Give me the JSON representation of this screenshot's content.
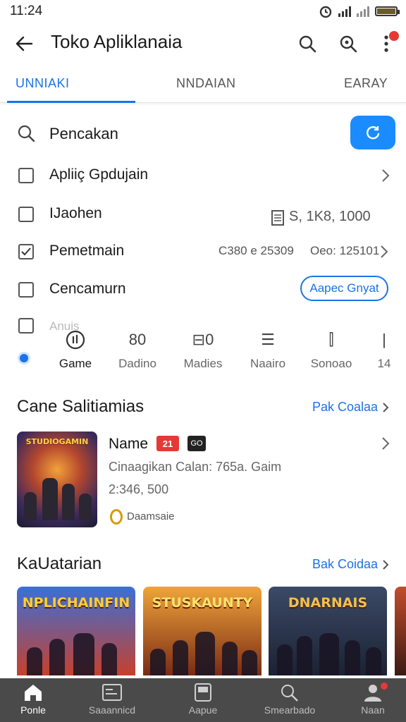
{
  "status_bar": {
    "time": "11:24"
  },
  "app_bar": {
    "title": "Toko Apliklanaia"
  },
  "tabs": [
    {
      "label": "UNNIAKI",
      "active": true
    },
    {
      "label": "NNDAIAN",
      "active": false
    },
    {
      "label": "EARAY",
      "active": false
    }
  ],
  "search": {
    "label": "Pencakan"
  },
  "filters": [
    {
      "label": "Apliiç Gpdujain",
      "checked": false
    },
    {
      "label": "IJaohen",
      "checked": false,
      "meta": "S,   1K8,   1000"
    },
    {
      "label": "Pemetmain",
      "checked": true,
      "meta_left": "C380 e 25309",
      "meta_right": "Oeo: 125101"
    },
    {
      "label": "Cencamurn",
      "checked": false,
      "button": "Aapec Gnyat"
    },
    {
      "label": "Anuis",
      "checked": false
    }
  ],
  "categories": [
    {
      "icon": "gamepad-icon",
      "glyph": "⏁",
      "label": "Game",
      "selected": true
    },
    {
      "icon": "book-icon",
      "glyph": "80",
      "label": "Dadino",
      "selected": false
    },
    {
      "icon": "media-icon",
      "glyph": "⊟0",
      "label": "Madies",
      "selected": false
    },
    {
      "icon": "doc-icon",
      "glyph": "☰",
      "label": "Naairo",
      "selected": false
    },
    {
      "icon": "tool-icon",
      "glyph": "⫿",
      "label": "Sonoao",
      "selected": false
    },
    {
      "icon": "more-icon",
      "glyph": "|",
      "label": "14",
      "selected": false
    }
  ],
  "section_featured": {
    "title": "Cane Salitiamias",
    "link": "Pak Coalaa"
  },
  "featured_app": {
    "logo_text": "STUDIOGAMIN",
    "name": "Name",
    "badge_red": "21",
    "badge_dark": "GO",
    "description": "Cinaagikan Calan: 765a. Gaim",
    "size": "2:346, 500",
    "developer": "Daamsaie"
  },
  "section_carousel": {
    "title": "KaUatarian",
    "link": "Bak Coidaa"
  },
  "carousel": [
    {
      "title": "NPLICHAINFIN",
      "bg_top": "#3a6fd8",
      "bg_bottom": "#c7402c",
      "title_color": "#ffcf2e"
    },
    {
      "title": "STUSKAUNTY",
      "bg_top": "#f0a43a",
      "bg_bottom": "#7a2a14",
      "title_color": "#ffe36b"
    },
    {
      "title": "DNARNAIS",
      "bg_top": "#3b4a66",
      "bg_bottom": "#1b2233",
      "title_color": "#f2c14e"
    },
    {
      "title": "",
      "bg_top": "#c44c2a",
      "bg_bottom": "#3a1a14",
      "title_color": "#ffd23a"
    }
  ],
  "bottom_nav": [
    {
      "icon": "home-icon",
      "label": "Ponle",
      "active": true
    },
    {
      "icon": "apps-icon",
      "label": "Saaannicd",
      "active": false
    },
    {
      "icon": "games-icon",
      "label": "Aapue",
      "active": false
    },
    {
      "icon": "search-library-icon",
      "label": "Smearbado",
      "active": false
    },
    {
      "icon": "profile-icon",
      "label": "Naan",
      "active": false
    }
  ],
  "colors": {
    "accent": "#1a73e8",
    "fab": "#1a8cff",
    "badge": "#e53935",
    "nav_bg": "#4a4a4a"
  }
}
